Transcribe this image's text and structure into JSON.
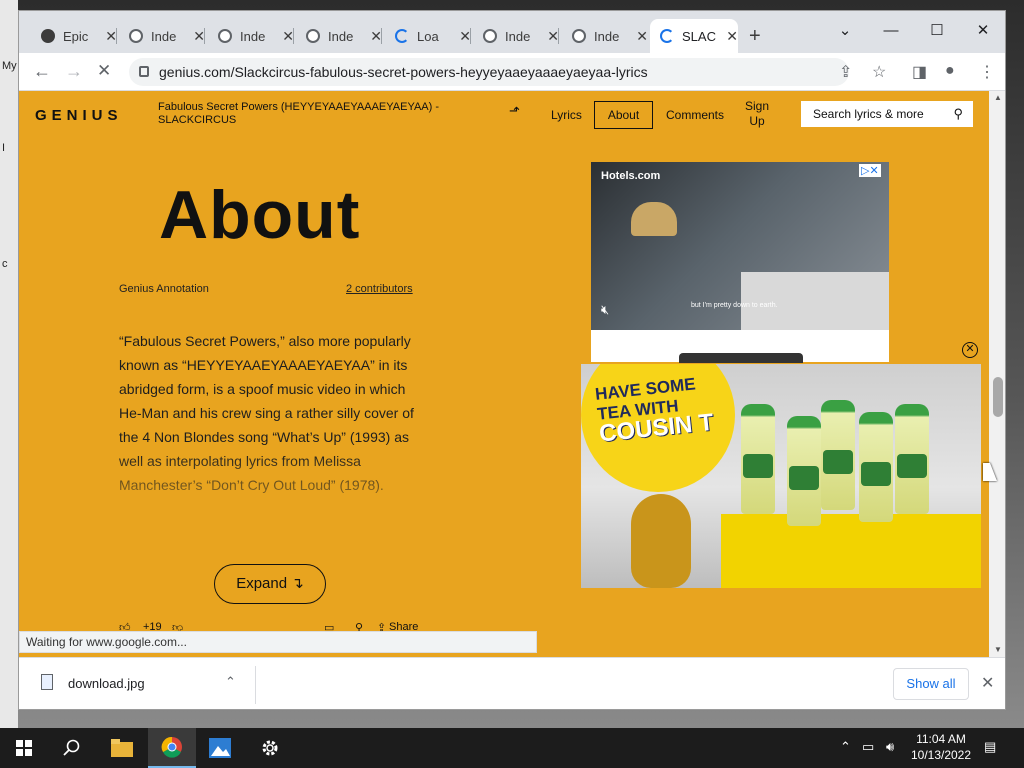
{
  "desktop": {
    "frag1": "My",
    "frag2": "I",
    "frag3": "c"
  },
  "browser": {
    "tabs": [
      {
        "label": "Epic",
        "icon": "pin-icon"
      },
      {
        "label": "Inde",
        "icon": "globe-icon"
      },
      {
        "label": "Inde",
        "icon": "globe-icon"
      },
      {
        "label": "Inde",
        "icon": "globe-icon"
      },
      {
        "label": "Loa",
        "icon": "loading-icon"
      },
      {
        "label": "Inde",
        "icon": "globe-icon"
      },
      {
        "label": "Inde",
        "icon": "globe-icon"
      },
      {
        "label": "SLAC",
        "icon": "loading-icon"
      }
    ],
    "new_tab": "+",
    "url": "genius.com/Slackcircus-fabulous-secret-powers-heyyeyaaeyaaaeyaeyaa-lyrics",
    "controls": {
      "minimize": "—",
      "maximize": "☐",
      "close": "✕",
      "menu": "⌄"
    }
  },
  "genius": {
    "logo": "GENIUS",
    "song_title": "Fabulous Secret Powers (HEYYEYAAEYAAAEYAEYAA) - SLACKCIRCUS",
    "nav": {
      "lyrics": "Lyrics",
      "about": "About",
      "comments": "Comments",
      "signup": "Sign Up"
    },
    "search_placeholder": "Search lyrics & more",
    "about_heading": "About",
    "annotation_label": "Genius Annotation",
    "contributors": "2 contributors",
    "body": "“Fabulous Secret Powers,” also more popularly known as “HEYYEYAAEYAAAEYAEYAA” in its abridged form, is a spoof music video in which He-Man and his crew sing a rather silly cover of the 4 Non Blondes song “What’s Up” (1993) as well as interpolating lyrics from Melissa Manchester’s “Don’t Cry Out Loud” (1978).",
    "expand": "Expand ↴",
    "upvotes": "+19",
    "share": "Share"
  },
  "ads": {
    "hotels_brand": "Hotels.com",
    "hotels_caption": "but I'm pretty down to earth.",
    "tea_line1": "HAVE SOME",
    "tea_line2": "TEA WITH",
    "tea_line3": "COUSIN T"
  },
  "status": "Waiting for www.google.com...",
  "download": {
    "filename": "download.jpg",
    "show_all": "Show all"
  },
  "taskbar": {
    "time": "11:04 AM",
    "date": "10/13/2022"
  },
  "colors": {
    "genius_yellow": "#e8a41f",
    "chrome_blue": "#1a73e8"
  }
}
